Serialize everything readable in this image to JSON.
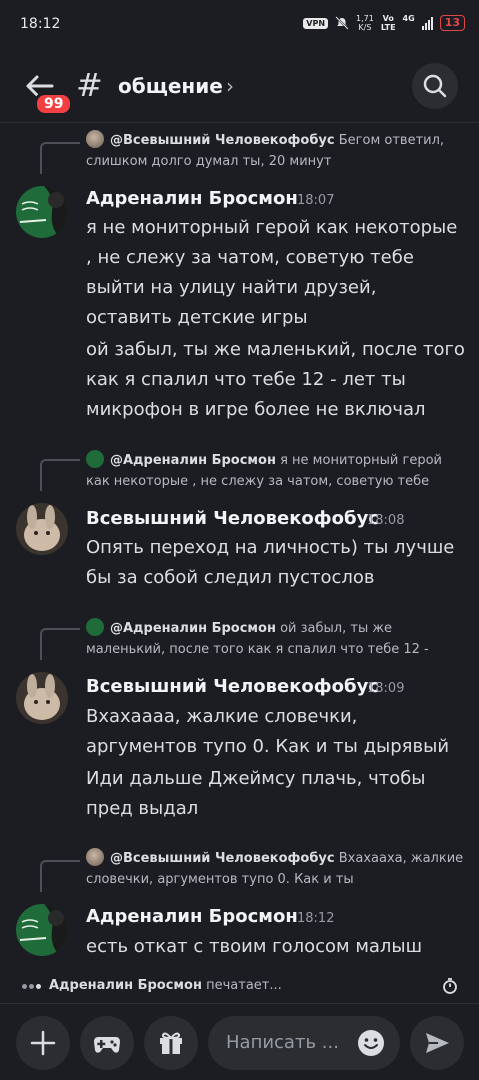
{
  "status_bar": {
    "time": "18:12",
    "vpn": "VPN",
    "speed_value": "1,71",
    "speed_unit": "K/S",
    "net_top": "Vo",
    "net_bottom": "LTE",
    "net_gen": "4G",
    "battery": "13"
  },
  "header": {
    "back_badge": "99",
    "hash": "#",
    "channel_name": "общение",
    "chevron": "›"
  },
  "messages": [
    {
      "reply": {
        "name": "@Всевышний Человекофобус",
        "text": " Бегом ответил, слишком долго думал ты, 20 минут"
      },
      "author": "Адреналин Бросмон",
      "time": "18:07",
      "lines": [
        "я не мониторный герой как некоторые , не слежу за чатом, советую тебе выйти на улицу найти друзей, оставить детские игры",
        "ой забыл, ты же маленький, после того как я спалил что тебе 12 - лет ты микрофон в игре более не включал"
      ]
    },
    {
      "reply": {
        "name": "@Адреналин Бросмон",
        "text": " я не мониторный герой как некоторые , не слежу за чатом, советую тебе"
      },
      "author": "Всевышний Человекофобус",
      "time": "18:08",
      "lines": [
        "Опять переход на личность) ты лучше бы за собой следил пустослов"
      ]
    },
    {
      "reply": {
        "name": "@Адреналин Бросмон",
        "text": " ой забыл, ты же маленький, после того как я спалил что тебе 12 -"
      },
      "author": "Всевышний Человекофобус",
      "time": "18:09",
      "lines": [
        "Вхахаааа, жалкие словечки, аргументов тупо 0. Как и ты дырявый",
        "Иди дальше Джеймсу плачь, чтобы пред выдал"
      ]
    },
    {
      "reply": {
        "name": "@Всевышний Человекофобус",
        "text": " Вхахааха, жалкие словечки, аргументов тупо 0. Как и ты"
      },
      "author": "Адреналин Бросмон",
      "time": "18:12",
      "lines": [
        "есть откат с твоим голосом малыш"
      ]
    }
  ],
  "typing": {
    "name": "Адреналин Бросмон",
    "suffix": " печатает..."
  },
  "input": {
    "placeholder": "Написать ..."
  },
  "icons": [
    "back-arrow-icon",
    "search-icon",
    "plus-icon",
    "gamepad-icon",
    "gift-icon",
    "emoji-icon",
    "send-icon",
    "timer-icon"
  ],
  "colors": {
    "background": "#1c1d22",
    "badge": "#f23f42",
    "battery": "#e04848"
  }
}
